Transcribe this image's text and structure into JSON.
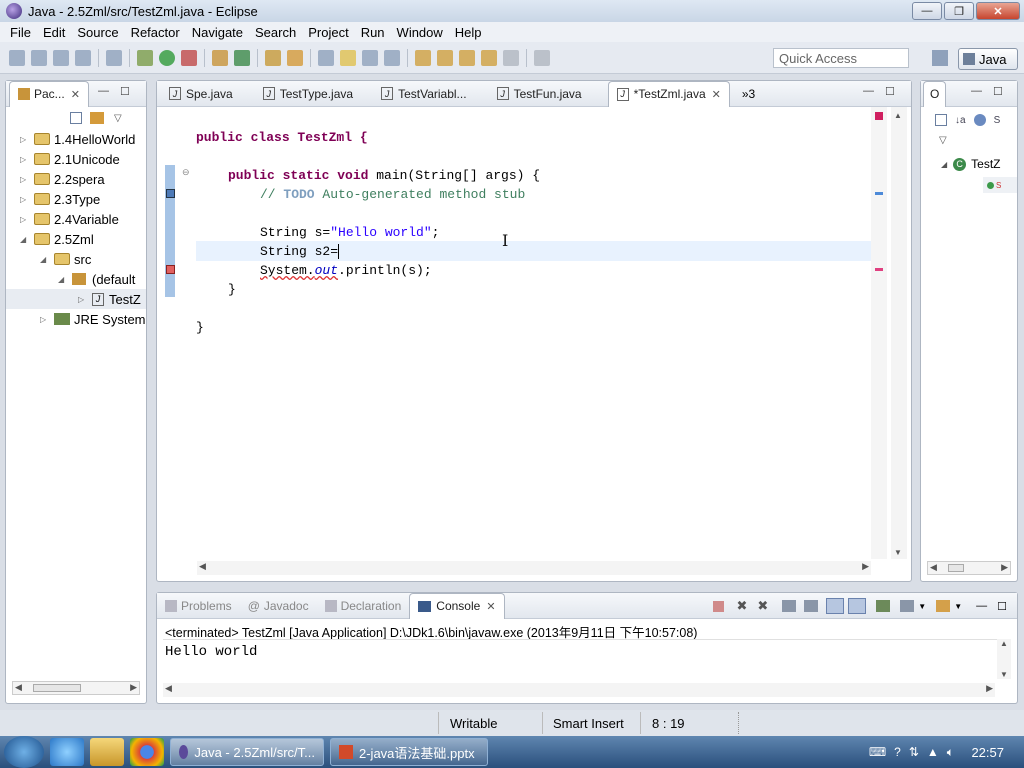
{
  "window": {
    "title": "Java - 2.5Zml/src/TestZml.java - Eclipse"
  },
  "menu": [
    "File",
    "Edit",
    "Source",
    "Refactor",
    "Navigate",
    "Search",
    "Project",
    "Run",
    "Window",
    "Help"
  ],
  "toolbar": {
    "quick_access_placeholder": "Quick Access",
    "perspective": "Java"
  },
  "package_explorer": {
    "tab": "Pac...",
    "items": [
      {
        "label": "1.4HelloWorld",
        "depth": 0,
        "expanded": false
      },
      {
        "label": "2.1Unicode",
        "depth": 0,
        "expanded": false
      },
      {
        "label": "2.2spera",
        "depth": 0,
        "expanded": false
      },
      {
        "label": "2.3Type",
        "depth": 0,
        "expanded": false
      },
      {
        "label": "2.4Variable",
        "depth": 0,
        "expanded": false
      },
      {
        "label": "2.5Zml",
        "depth": 0,
        "expanded": true
      },
      {
        "label": "src",
        "depth": 1,
        "expanded": true
      },
      {
        "label": "(default",
        "depth": 2,
        "expanded": true
      },
      {
        "label": "TestZ",
        "depth": 3,
        "expanded": false
      },
      {
        "label": "JRE System",
        "depth": 1,
        "expanded": false
      }
    ]
  },
  "editor": {
    "tabs": [
      {
        "label": "Spe.java",
        "active": false
      },
      {
        "label": "TestType.java",
        "active": false
      },
      {
        "label": "TestVariabl...",
        "active": false
      },
      {
        "label": "TestFun.java",
        "active": false
      },
      {
        "label": "*TestZml.java",
        "active": true
      }
    ],
    "overflow": "»3",
    "code": {
      "l1": "public class TestZml {",
      "l2": "public static void main(String[] args) {",
      "l3a": "// ",
      "l3b": "TODO",
      "l3c": " Auto-generated method stub",
      "l4a": "String s=",
      "l4b": "\"Hello world\"",
      "l4c": ";",
      "l5": "String s2=",
      "l6a": "System.",
      "l6b": "out",
      "l6c": ".println(s);",
      "l7": "}",
      "l8": "}"
    }
  },
  "outline": {
    "tab": "O",
    "item": "TestZ"
  },
  "bottom": {
    "tabs": [
      "Problems",
      "Javadoc",
      "Declaration",
      "Console"
    ],
    "active_tab": "Console",
    "status": "<terminated> TestZml [Java Application] D:\\JDk1.6\\bin\\javaw.exe (2013年9月11日 下午10:57:08)",
    "output": "Hello world"
  },
  "statusbar": {
    "writable": "Writable",
    "insert": "Smart Insert",
    "position": "8 : 19"
  },
  "taskbar": {
    "tasks": [
      "Java - 2.5Zml/src/T...",
      "2-java语法基础.pptx"
    ],
    "clock": "22:57"
  }
}
